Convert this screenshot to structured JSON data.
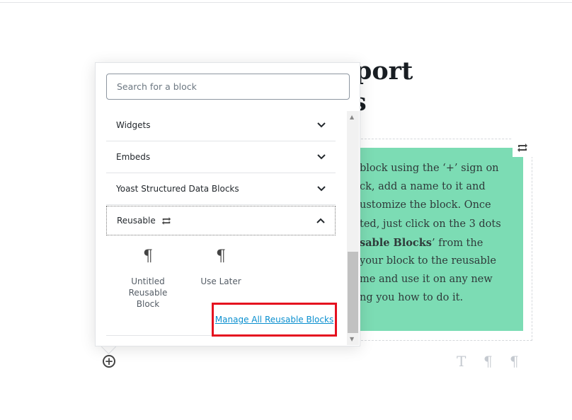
{
  "post": {
    "title_line1_visible": "xport",
    "title_line2_visible": "s",
    "paragraph_lines": [
      {
        "text": "block using the ‘+’ sign on"
      },
      {
        "text": "ck, add a name to it and"
      },
      {
        "text": "ustomize the block. Once"
      },
      {
        "text": "ted, just click on the 3 dots"
      },
      {
        "bold": "sable Blocks",
        "text": "’ from the"
      },
      {
        "text": "your block to the reusable"
      },
      {
        "text": "me and use it on any new"
      },
      {
        "text": "ng you how to do it."
      }
    ],
    "block_bg_color": "#7cdcb4"
  },
  "inserter": {
    "search_placeholder": "Search for a block",
    "categories": [
      {
        "label": "Widgets",
        "expanded": false
      },
      {
        "label": "Embeds",
        "expanded": false
      },
      {
        "label": "Yoast Structured Data Blocks",
        "expanded": false
      },
      {
        "label": "Reusable",
        "expanded": true
      }
    ],
    "reusable_blocks": [
      {
        "label": "Untitled Reusable Block",
        "icon": "paragraph-icon"
      },
      {
        "label": "Use Later",
        "icon": "paragraph-icon"
      }
    ],
    "manage_link": "Manage All Reusable Blocks",
    "highlight_color": "#e5101f"
  },
  "toolbar_icons": [
    "heading-icon",
    "paragraph-icon",
    "paragraph-icon"
  ]
}
